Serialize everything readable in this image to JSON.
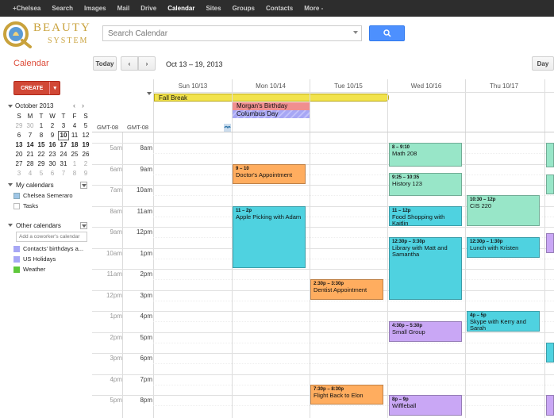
{
  "topnav": [
    "+Chelsea",
    "Search",
    "Images",
    "Mail",
    "Drive",
    "Calendar",
    "Sites",
    "Groups",
    "Contacts",
    "More -"
  ],
  "logo": {
    "line1": "BEAUTY",
    "line2": "SYSTEM"
  },
  "search": {
    "placeholder": "Search Calendar"
  },
  "toolbar": {
    "title": "Calendar",
    "today": "Today",
    "prev": "‹",
    "next": "›",
    "range": "Oct 13 – 19, 2013",
    "day": "Day"
  },
  "create": {
    "label": "CREATE"
  },
  "mini": {
    "month": "October 2013",
    "prev": "‹",
    "next": "›",
    "weekdays": [
      "S",
      "M",
      "T",
      "W",
      "T",
      "F",
      "S"
    ],
    "weeks": [
      [
        "29",
        "30",
        "1",
        "2",
        "3",
        "4",
        "5"
      ],
      [
        "6",
        "7",
        "8",
        "9",
        "10",
        "11",
        "12"
      ],
      [
        "13",
        "14",
        "15",
        "16",
        "17",
        "18",
        "19"
      ],
      [
        "20",
        "21",
        "22",
        "23",
        "24",
        "25",
        "26"
      ],
      [
        "27",
        "28",
        "29",
        "30",
        "31",
        "1",
        "2"
      ],
      [
        "3",
        "4",
        "5",
        "6",
        "7",
        "8",
        "9"
      ]
    ]
  },
  "my_calendars": {
    "title": "My calendars",
    "items": [
      {
        "label": "Chelsea Semeraro",
        "color": "#9fc6e7"
      },
      {
        "label": "Tasks",
        "color": "#ffffff"
      }
    ]
  },
  "other_calendars": {
    "title": "Other calendars",
    "placeholder": "Add a coworker's calendar",
    "items": [
      {
        "label": "Contacts' birthdays a...",
        "color": "#a7a7f5"
      },
      {
        "label": "US Holidays",
        "color": "#a7a7f5"
      },
      {
        "label": "Weather",
        "color": "#5fc83b"
      }
    ]
  },
  "grid": {
    "tz_left": "GMT-08",
    "tz_right": "GMT-08",
    "days": [
      "Sun 10/13",
      "Mon 10/14",
      "Tue 10/15",
      "Wed 10/16",
      "Thu 10/17"
    ],
    "times_left": [
      "5am",
      "6am",
      "7am",
      "8am",
      "9am",
      "10am",
      "11am",
      "12pm",
      "1pm",
      "2pm",
      "3pm",
      "4pm",
      "5pm"
    ],
    "times_right": [
      "8am",
      "9am",
      "10am",
      "11am",
      "12pm",
      "1pm",
      "2pm",
      "3pm",
      "4pm",
      "5pm",
      "6pm",
      "7pm",
      "8pm"
    ]
  },
  "allday": [
    {
      "label": "Fall Break",
      "color": "#f2e34c"
    },
    {
      "label": "Morgan's Birthday",
      "color": "#f08f8f"
    },
    {
      "label": "Columbus Day",
      "color": "#a7a7f5"
    }
  ],
  "events": [
    {
      "time": "9 – 10",
      "title": "Doctor's Appointment",
      "color": "#ffad5f"
    },
    {
      "time": "11 – 2p",
      "title": "Apple Picking with Adam",
      "color": "#4fd2e0"
    },
    {
      "time": "2:30p – 3:30p",
      "title": "Dentist Appointment",
      "color": "#ffad5f"
    },
    {
      "time": "7:30p – 8:30p",
      "title": "Flight Back to Elon",
      "color": "#ffad5f"
    },
    {
      "time": "8 – 9:10",
      "title": "Math 208",
      "color": "#98e6c8"
    },
    {
      "time": "9:25 – 10:35",
      "title": "History 123",
      "color": "#98e6c8"
    },
    {
      "time": "11 – 12p",
      "title": "Food Shopping with Kaitlin",
      "color": "#4fd2e0"
    },
    {
      "time": "12:30p – 3:30p",
      "title": "Library with Matt and Samantha",
      "color": "#4fd2e0"
    },
    {
      "time": "4:30p – 5:30p",
      "title": "Small Group",
      "color": "#c9a7f5"
    },
    {
      "time": "8p – 9p",
      "title": "Wiffleball",
      "color": "#c9a7f5"
    },
    {
      "time": "10:30 – 12p",
      "title": "CIS 220",
      "color": "#98e6c8"
    },
    {
      "time": "12:30p – 1:30p",
      "title": "Lunch with Kristen",
      "color": "#4fd2e0"
    },
    {
      "time": "4p – 5p",
      "title": "Skype with Kerry and Sarah",
      "color": "#4fd2e0"
    }
  ]
}
